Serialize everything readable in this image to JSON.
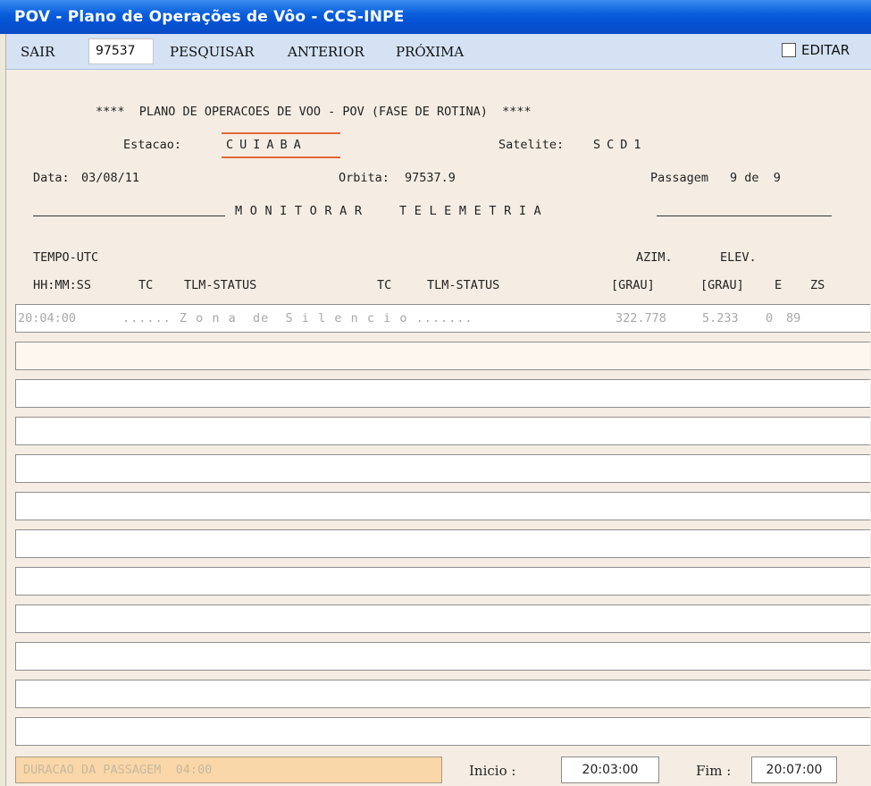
{
  "window": {
    "title": "POV - Plano de Operações de Vôo - CCS-INPE"
  },
  "menu": {
    "sair": "SAIR",
    "orbit_number": "97537",
    "pesquisar": "PESQUISAR",
    "anterior": "ANTERIOR",
    "proxima": "PRÓXIMA",
    "editar": "EDITAR",
    "editar_checked": false
  },
  "header": {
    "title": "****  PLANO DE OPERACOES DE VOO - POV (FASE DE ROTINA)  ****",
    "estacao_label": "Estacao:",
    "estacao_value": "CUIABA",
    "satelite_label": "Satelite:",
    "satelite_value": "SCD1",
    "data_label": "Data:",
    "data_value": "03/08/11",
    "orbita_label": "Orbita:",
    "orbita_value": "97537.9",
    "passagem_label": "Passagem",
    "passagem_value": "9 de  9",
    "section_title": "MONITORAR  TELEMETRIA"
  },
  "table": {
    "group_header_1": "TEMPO-UTC",
    "group_header_azim": "AZIM.",
    "group_header_elev": "ELEV.",
    "columns": [
      "HH:MM:SS",
      "TC",
      "TLM-STATUS",
      "TC",
      "TLM-STATUS",
      "[GRAU]",
      "[GRAU]",
      "E",
      "ZS"
    ],
    "rows": [
      {
        "time": "20:04:00",
        "description": "...... Z o n a  de  S i l e n c i o .......",
        "azim": "322.778",
        "elev": "5.233",
        "e": "0",
        "zs": "89"
      }
    ],
    "empty_rows": 11
  },
  "footer": {
    "duracao": "DURACAO DA PASSAGEM  04:00",
    "inicio_label": "Inicio :",
    "inicio_value": "20:03:00",
    "fim_label": "Fim :",
    "fim_value": "20:07:00"
  },
  "colors": {
    "title_blue": "#0a5fdc",
    "menubar": "#d4e2f4",
    "accent_underline": "#e0683b",
    "duration_box": "#f9d7a8"
  }
}
